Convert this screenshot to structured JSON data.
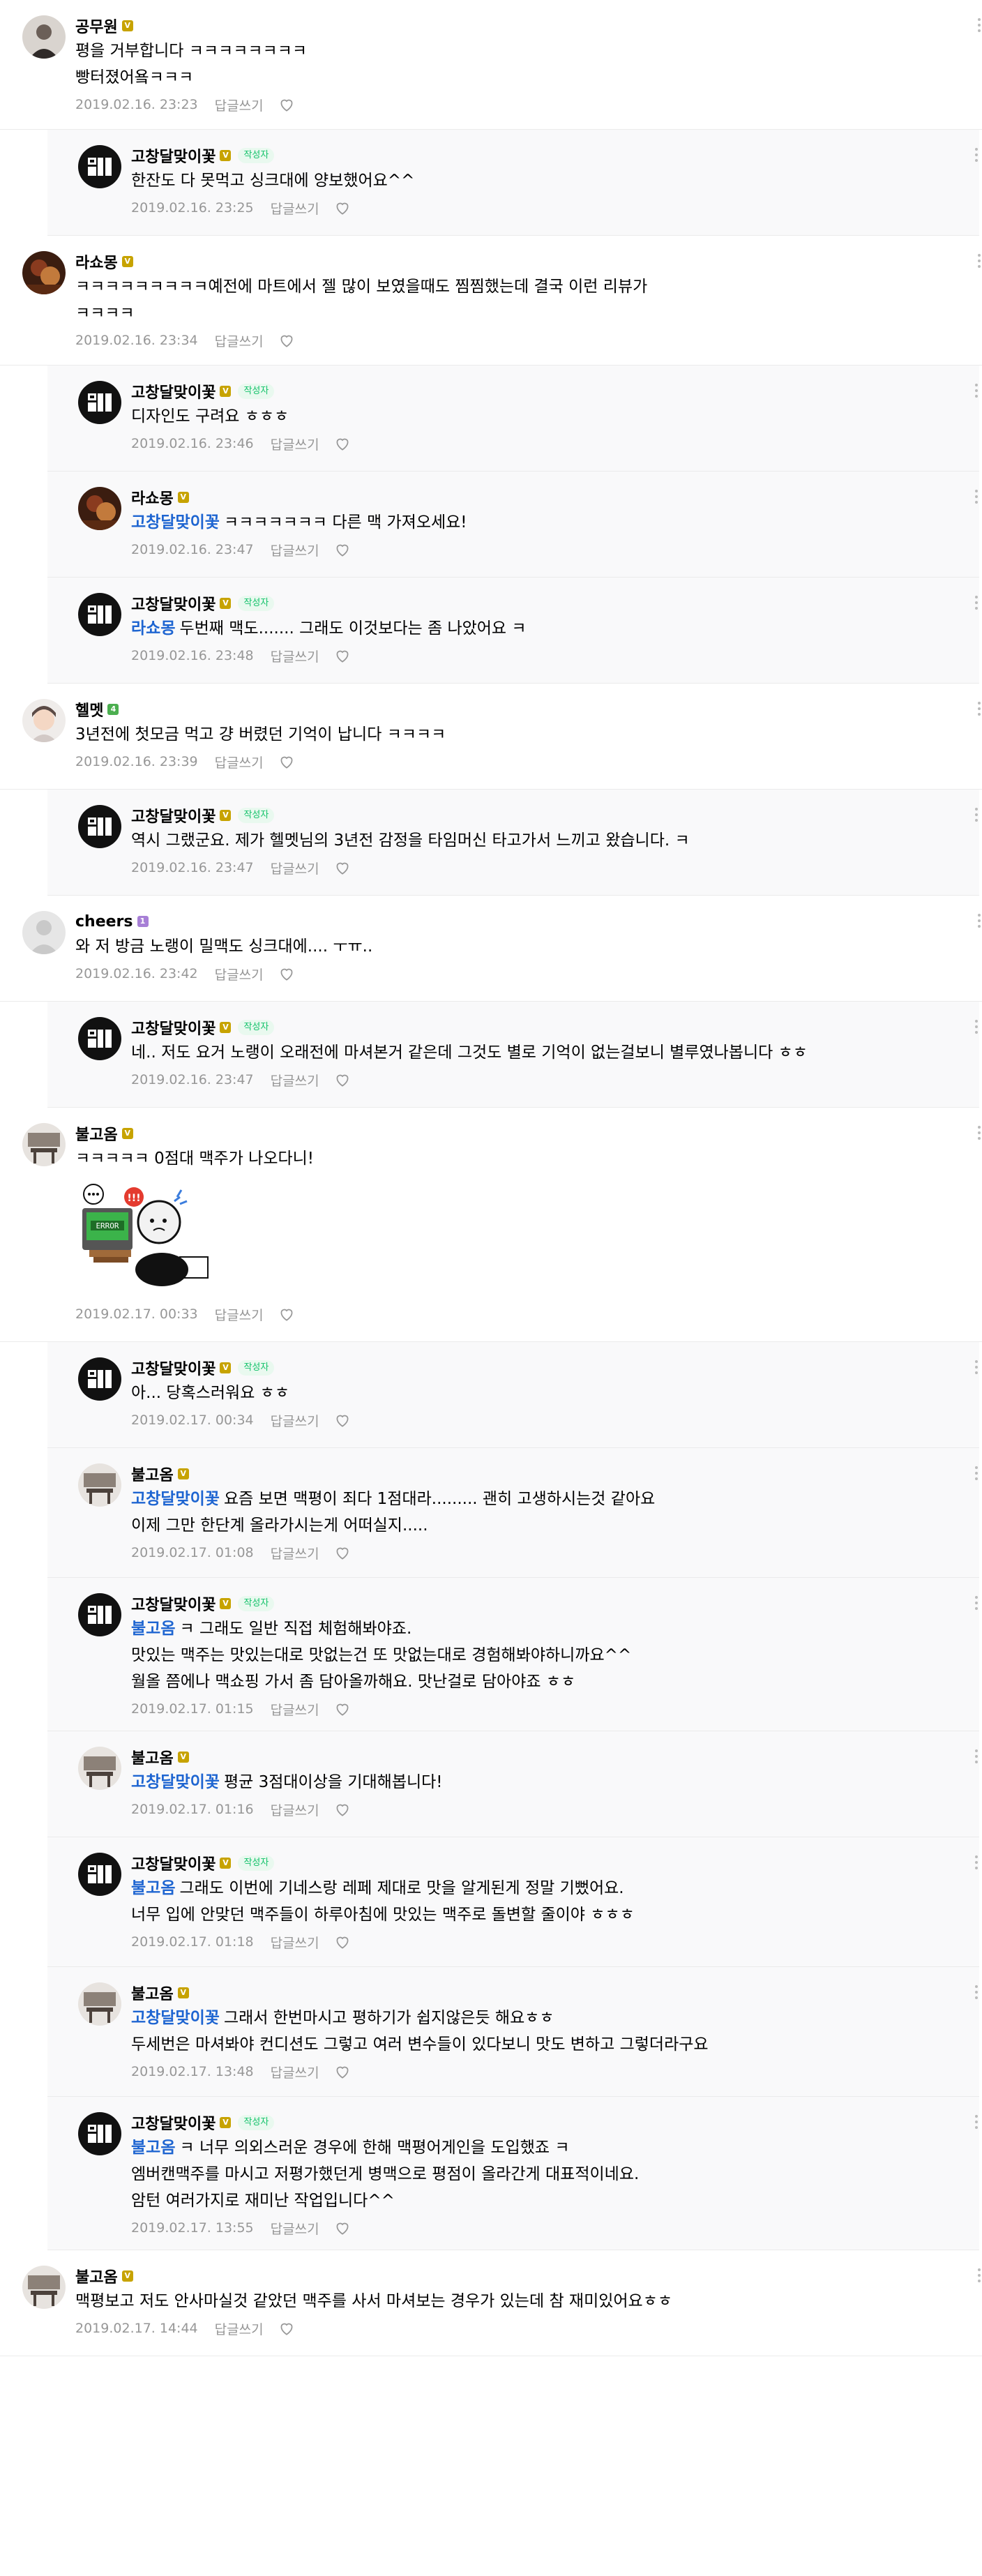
{
  "labels": {
    "reply": "답글쓰기",
    "writer": "작성자"
  },
  "colors": {
    "mention": "#1e65d1",
    "meta": "#979797",
    "writer_badge_bg": "#e9f9ef",
    "writer_badge_text": "#13c26a",
    "level_badge": "#c7a300",
    "reply_bg": "#f9f9fa"
  },
  "comments": [
    {
      "kind": "top",
      "author": "공무원",
      "avatar": "user",
      "badge": "V",
      "writer": false,
      "mention": "",
      "lines": [
        "평을 거부합니다 ㅋㅋㅋㅋㅋㅋㅋㅋ",
        "빵터졌어욬ㅋㅋㅋ"
      ],
      "date": "2019.02.16. 23:23"
    },
    {
      "kind": "reply",
      "author": "고창달맞이꽃",
      "avatar": "logo",
      "badge": "V",
      "writer": true,
      "mention": "",
      "lines": [
        "한잔도 다 못먹고 싱크대에 양보했어요^^"
      ],
      "date": "2019.02.16. 23:25"
    },
    {
      "kind": "top",
      "author": "라쇼몽",
      "avatar": "brown",
      "badge": "V",
      "writer": false,
      "mention": "",
      "lines": [
        "ㅋㅋㅋㅋㅋㅋㅋㅋㅋ예전에 마트에서 젤 많이 보였을때도 찜찜했는데 결국 이런 리뷰가",
        "ㅋㅋㅋㅋ"
      ],
      "date": "2019.02.16. 23:34"
    },
    {
      "kind": "reply",
      "author": "고창달맞이꽃",
      "avatar": "logo",
      "badge": "V",
      "writer": true,
      "mention": "",
      "lines": [
        "디자인도 구려요 ㅎㅎㅎ"
      ],
      "date": "2019.02.16. 23:46"
    },
    {
      "kind": "reply",
      "author": "라쇼몽",
      "avatar": "brown",
      "badge": "V",
      "writer": false,
      "mention": "고창달맞이꽃",
      "lines": [
        "ㅋㅋㅋㅋㅋㅋㅋ 다른 맥 가져오세요!"
      ],
      "date": "2019.02.16. 23:47"
    },
    {
      "kind": "reply",
      "author": "고창달맞이꽃",
      "avatar": "logo",
      "badge": "V",
      "writer": true,
      "mention": "라쇼몽",
      "lines": [
        "두번째 맥도....... 그래도 이것보다는 좀 나았어요 ㅋ"
      ],
      "date": "2019.02.16. 23:48"
    },
    {
      "kind": "top",
      "author": "헬멧",
      "avatar": "helmet",
      "badge": "4",
      "writer": false,
      "mention": "",
      "lines": [
        "3년전에 첫모금 먹고 걍 버렸던 기억이 납니다 ㅋㅋㅋㅋ"
      ],
      "date": "2019.02.16. 23:39"
    },
    {
      "kind": "reply",
      "author": "고창달맞이꽃",
      "avatar": "logo",
      "badge": "V",
      "writer": true,
      "mention": "",
      "lines": [
        "역시 그랬군요. 제가 헬멧님의 3년전 감정을 타임머신 타고가서 느끼고 왔습니다. ㅋ"
      ],
      "date": "2019.02.16. 23:47"
    },
    {
      "kind": "top",
      "author": "cheers",
      "avatar": "default",
      "badge": "1",
      "writer": false,
      "mention": "",
      "lines": [
        "와 저 방금 노랭이 밀맥도 싱크대에.... ㅜㅠ.."
      ],
      "date": "2019.02.16. 23:42"
    },
    {
      "kind": "reply",
      "author": "고창달맞이꽃",
      "avatar": "logo",
      "badge": "V",
      "writer": true,
      "mention": "",
      "lines": [
        "네.. 저도 요거 노랭이 오래전에 마셔본거 같은데 그것도 별로 기억이 없는걸보니 별루였나봅니다 ㅎㅎ"
      ],
      "date": "2019.02.16. 23:47"
    },
    {
      "kind": "top",
      "author": "불고옴",
      "avatar": "desk",
      "badge": "V",
      "writer": false,
      "mention": "",
      "lines": [
        "ㅋㅋㅋㅋㅋ 0점대 맥주가 나오다니!"
      ],
      "date": "2019.02.17. 00:33",
      "sticker": true
    },
    {
      "kind": "reply",
      "author": "고창달맞이꽃",
      "avatar": "logo",
      "badge": "V",
      "writer": true,
      "mention": "",
      "lines": [
        "아... 당혹스러워요 ㅎㅎ"
      ],
      "date": "2019.02.17. 00:34"
    },
    {
      "kind": "reply",
      "author": "불고옴",
      "avatar": "desk",
      "badge": "V",
      "writer": false,
      "mention": "고창달맞이꽃",
      "lines": [
        "요즘 보면 맥평이 죄다 1점대라......... 괜히 고생하시는것 같아요",
        "이제 그만 한단계 올라가시는게 어떠실지....."
      ],
      "date": "2019.02.17. 01:08"
    },
    {
      "kind": "reply",
      "author": "고창달맞이꽃",
      "avatar": "logo",
      "badge": "V",
      "writer": true,
      "mention": "불고옴",
      "lines": [
        "ㅋ 그래도 일반 직접 체험해봐야죠.",
        "맛있는 맥주는 맛있는대로 맛없는건 또 맛없는대로 경험해봐야하니까요^^",
        "월올 쯤에나 맥쇼핑 가서 좀 담아올까해요. 맛난걸로 담아야죠 ㅎㅎ"
      ],
      "date": "2019.02.17. 01:15"
    },
    {
      "kind": "reply",
      "author": "불고옴",
      "avatar": "desk",
      "badge": "V",
      "writer": false,
      "mention": "고창달맞이꽃",
      "lines": [
        "평균 3점대이상을 기대해봅니다!"
      ],
      "date": "2019.02.17. 01:16"
    },
    {
      "kind": "reply",
      "author": "고창달맞이꽃",
      "avatar": "logo",
      "badge": "V",
      "writer": true,
      "mention": "불고옴",
      "lines": [
        "그래도 이번에 기네스랑 레페 제대로 맛을 알게된게 정말 기뻤어요.",
        "너무 입에 안맞던 맥주들이 하루아침에 맛있는 맥주로 돌변할 줄이야 ㅎㅎㅎ"
      ],
      "date": "2019.02.17. 01:18"
    },
    {
      "kind": "reply",
      "author": "불고옴",
      "avatar": "desk",
      "badge": "V",
      "writer": false,
      "mention": "고창달맞이꽃",
      "lines": [
        "그래서 한번마시고 평하기가 쉽지않은듯 해요ㅎㅎ",
        "두세번은 마셔봐야 컨디션도 그렇고 여러 변수들이 있다보니 맛도 변하고 그렇더라구요"
      ],
      "date": "2019.02.17. 13:48"
    },
    {
      "kind": "reply",
      "author": "고창달맞이꽃",
      "avatar": "logo",
      "badge": "V",
      "writer": true,
      "mention": "불고옴",
      "lines": [
        "ㅋ 너무 의외스러운 경우에 한해 맥평어게인을 도입했죠 ㅋ",
        "엠버캔맥주를 마시고 저평가했던게 병맥으로 평점이 올라간게 대표적이네요.",
        "암턴 여러가지로 재미난 작업입니다^^"
      ],
      "date": "2019.02.17. 13:55"
    },
    {
      "kind": "top",
      "author": "불고옴",
      "avatar": "desk",
      "badge": "V",
      "writer": false,
      "mention": "",
      "lines": [
        "맥평보고 저도 안사마실것 같았던 맥주를 사서 마셔보는 경우가 있는데 참 재미있어요ㅎㅎ"
      ],
      "date": "2019.02.17. 14:44"
    }
  ]
}
